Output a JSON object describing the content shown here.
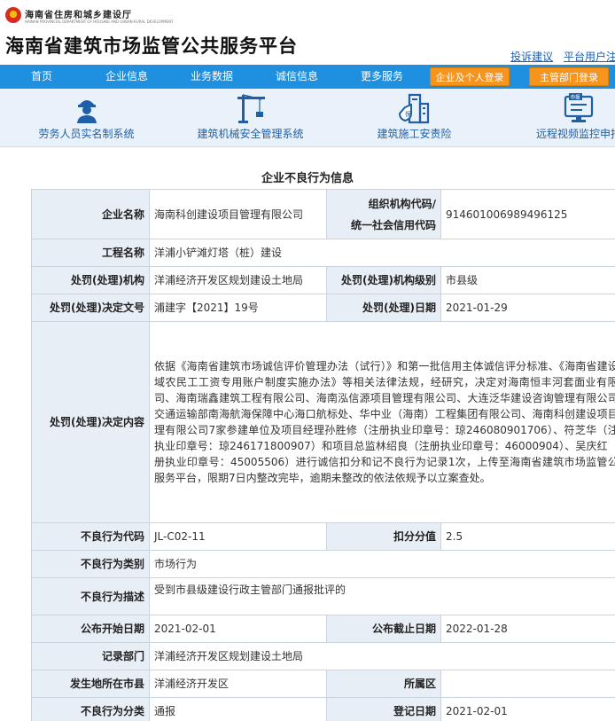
{
  "header": {
    "dept_name": "海南省住房和城乡建设厅",
    "dept_name_en": "HAINAN PROVINCIAL DEPARTMENT OF HOUSING AND URBAN-RURAL DEVELOPMENT",
    "site_title": "海南省建筑市场监管公共服务平台",
    "links": [
      "投诉建议",
      "平台用户注"
    ]
  },
  "nav": {
    "items": [
      "首页",
      "企业信息",
      "业务数据",
      "诚信信息",
      "更多服务"
    ],
    "buttons": [
      "企业及个人登录",
      "主管部门登录"
    ]
  },
  "systems": [
    {
      "label": "劳务人员实名制系统",
      "icon": "worker-icon"
    },
    {
      "label": "建筑机械安全管理系统",
      "icon": "tower-crane-icon"
    },
    {
      "label": "建筑施工安责险",
      "icon": "insurance-building-icon"
    },
    {
      "label": "远程视频监控申报",
      "icon": "monitor-icon"
    }
  ],
  "record": {
    "title": "企业不良行为信息",
    "company_name_label": "企业名称",
    "company_name": "海南科创建设项目管理有限公司",
    "org_code_label_1": "组织机构代码/",
    "org_code_label_2": "统一社会信用代码",
    "org_code": "914601006989496125",
    "project_label": "工程名称",
    "project": "洋浦小铲滩灯塔（桩）建设",
    "agency_label": "处罚(处理)机构",
    "agency": "洋浦经济开发区规划建设土地局",
    "agency_level_label": "处罚(处理)机构级别",
    "agency_level": "市县级",
    "doc_no_label": "处罚(处理)决定文号",
    "doc_no": "浦建字【2021】19号",
    "decision_date_label": "处罚(处理)日期",
    "decision_date": "2021-01-29",
    "content_label": "处罚(处理)决定内容",
    "content": "依据《海南省建筑市场诚信评价管理办法（试行）》和第一批信用主体诚信评分标准、《海南省建设领域农民工工资专用账户制度实施办法》等相关法律法规，经研究，决定对海南恒丰河套面业有限公司、海南瑞鑫建筑工程有限公司、海南泓信源项目管理有限公司、大连泛华建设咨询管理有限公司、交通运输部南海航海保障中心海口航标处、华中业（海南）工程集团有限公司、海南科创建设项目管理有限公司7家参建单位及项目经理孙胜修（注册执业印章号：琼246080901706）、符芝华（注册执业印章号：琼246171800907）和项目总监林绍良（注册执业印章号：46000904）、吴庆红（注册执业印章号：45005506）进行诚信扣分和记不良行为记录1次，上传至海南省建筑市场监管公共服务平台，限期7日内整改完毕，逾期未整改的依法依规予以立案查处。",
    "behavior_code_label": "不良行为代码",
    "behavior_code": "JL-C02-11",
    "score_label": "扣分分值",
    "score": "2.5",
    "behavior_type_label": "不良行为类别",
    "behavior_type": "市场行为",
    "behavior_desc_label": "不良行为描述",
    "behavior_desc": "受到市县级建设行政主管部门通报批评的",
    "publish_start_label": "公布开始日期",
    "publish_start": "2021-02-01",
    "publish_end_label": "公布截止日期",
    "publish_end": "2022-01-28",
    "record_dept_label": "记录部门",
    "record_dept": "洋浦经济开发区规划建设土地局",
    "location_label": "发生地所在市县",
    "location": "洋浦经济开发区",
    "district_label": "所属区",
    "district": "",
    "category_label": "不良行为分类",
    "category": "通报",
    "register_date_label": "登记日期",
    "register_date": "2021-02-01"
  },
  "colors": {
    "nav_bg": "#1f8fe0",
    "login_button": "#f7941d",
    "label_bg": "#e8eef5",
    "link": "#1d5fb4"
  }
}
